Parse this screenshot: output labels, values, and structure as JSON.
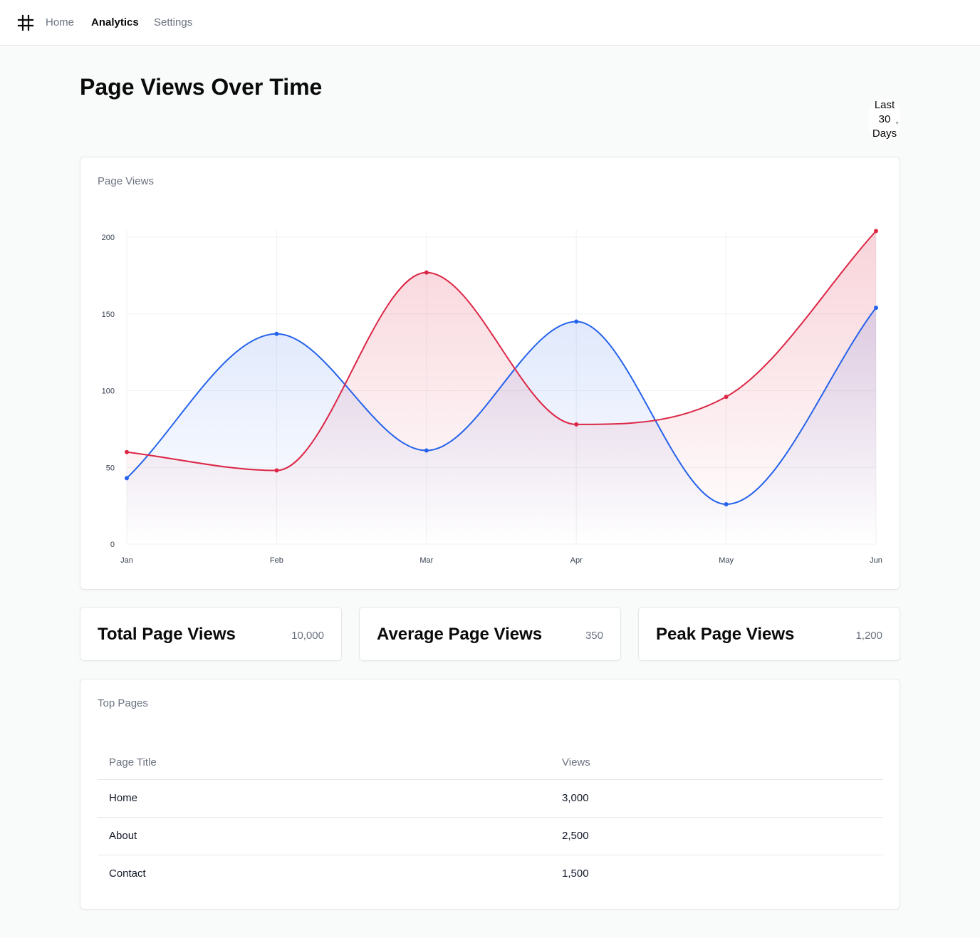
{
  "nav": {
    "items": [
      {
        "label": "Home",
        "active": false
      },
      {
        "label": "Analytics",
        "active": true
      },
      {
        "label": "Settings",
        "active": false
      }
    ]
  },
  "header": {
    "title": "Page Views Over Time"
  },
  "range_select": {
    "line1": "Last",
    "line2": "30",
    "line3": "Days"
  },
  "chart_card": {
    "label": "Page Views"
  },
  "chart_data": {
    "type": "area",
    "categories": [
      "Jan",
      "Feb",
      "Mar",
      "Apr",
      "May",
      "Jun"
    ],
    "ylim": [
      0,
      200
    ],
    "yticks": [
      0,
      50,
      100,
      150,
      200
    ],
    "grid": true,
    "series": [
      {
        "values": [
          43,
          137,
          61,
          145,
          26,
          154
        ],
        "color": "#2563eb"
      },
      {
        "values": [
          60,
          48,
          177,
          78,
          96,
          204
        ],
        "color": "#dc2645"
      }
    ]
  },
  "stats": [
    {
      "title": "Total Page Views",
      "value": "10,000"
    },
    {
      "title": "Average Page Views",
      "value": "350"
    },
    {
      "title": "Peak Page Views",
      "value": "1,200"
    }
  ],
  "top_pages": {
    "label": "Top Pages",
    "columns": [
      "Page Title",
      "Views"
    ],
    "rows": [
      [
        "Home",
        "3,000"
      ],
      [
        "About",
        "2,500"
      ],
      [
        "Contact",
        "1,500"
      ]
    ]
  }
}
